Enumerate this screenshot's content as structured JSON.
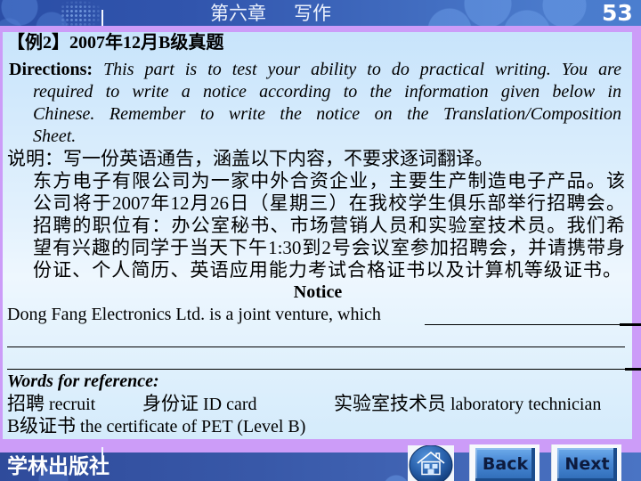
{
  "header": {
    "chapter": "第六章",
    "section": "写作",
    "page_number": "53"
  },
  "content": {
    "heading": "【例2】2007年12月B级真题",
    "directions": {
      "label": "Directions:",
      "lines": [
        "This part is to test your ability to do practical writing. You are",
        "required to write a notice according to the information given below in",
        "Chinese. Remember to write the notice on the Translation/Composition",
        "Sheet."
      ]
    },
    "instructions": {
      "lines": [
        "说明：写一份英语通告，涵盖以下内容，不要求逐词翻译。",
        "东方电子有限公司为一家中外合资企业，主要生产制造电子产品。该",
        "公司将于2007年12月26日（星期三）在我校学生俱乐部举行招聘会。",
        "招聘的职位有：办公室秘书、市场营销人员和实验室技术员。我们希",
        "望有兴趣的同学于当天下午1:30到2号会议室参加招聘会，并请携带身",
        "份证、个人简历、英语应用能力考试合格证书以及计算机等级证书。"
      ]
    },
    "notice": {
      "title": "Notice",
      "opening": "Dong Fang Electronics Ltd. is a joint venture, which"
    },
    "reference": {
      "heading": "Words for reference:",
      "terms": [
        {
          "zh": "招聘",
          "en": "recruit"
        },
        {
          "zh": "身份证",
          "en": "ID card"
        },
        {
          "zh": "实验室技术员",
          "en": "laboratory technician"
        },
        {
          "zh": "B级证书",
          "en": "the certificate of PET (Level B)"
        }
      ]
    }
  },
  "footer": {
    "publisher": "学林出版社",
    "nav": {
      "home_icon": "house-icon",
      "back": "Back",
      "next": "Next"
    }
  },
  "colors": {
    "frame_purple": "#cc9cf8",
    "header_blue": "#3155ad",
    "panel_blue": "#d6ecfc",
    "button_blue": "#4a8ad6",
    "button_text": "#0d1b3e"
  }
}
